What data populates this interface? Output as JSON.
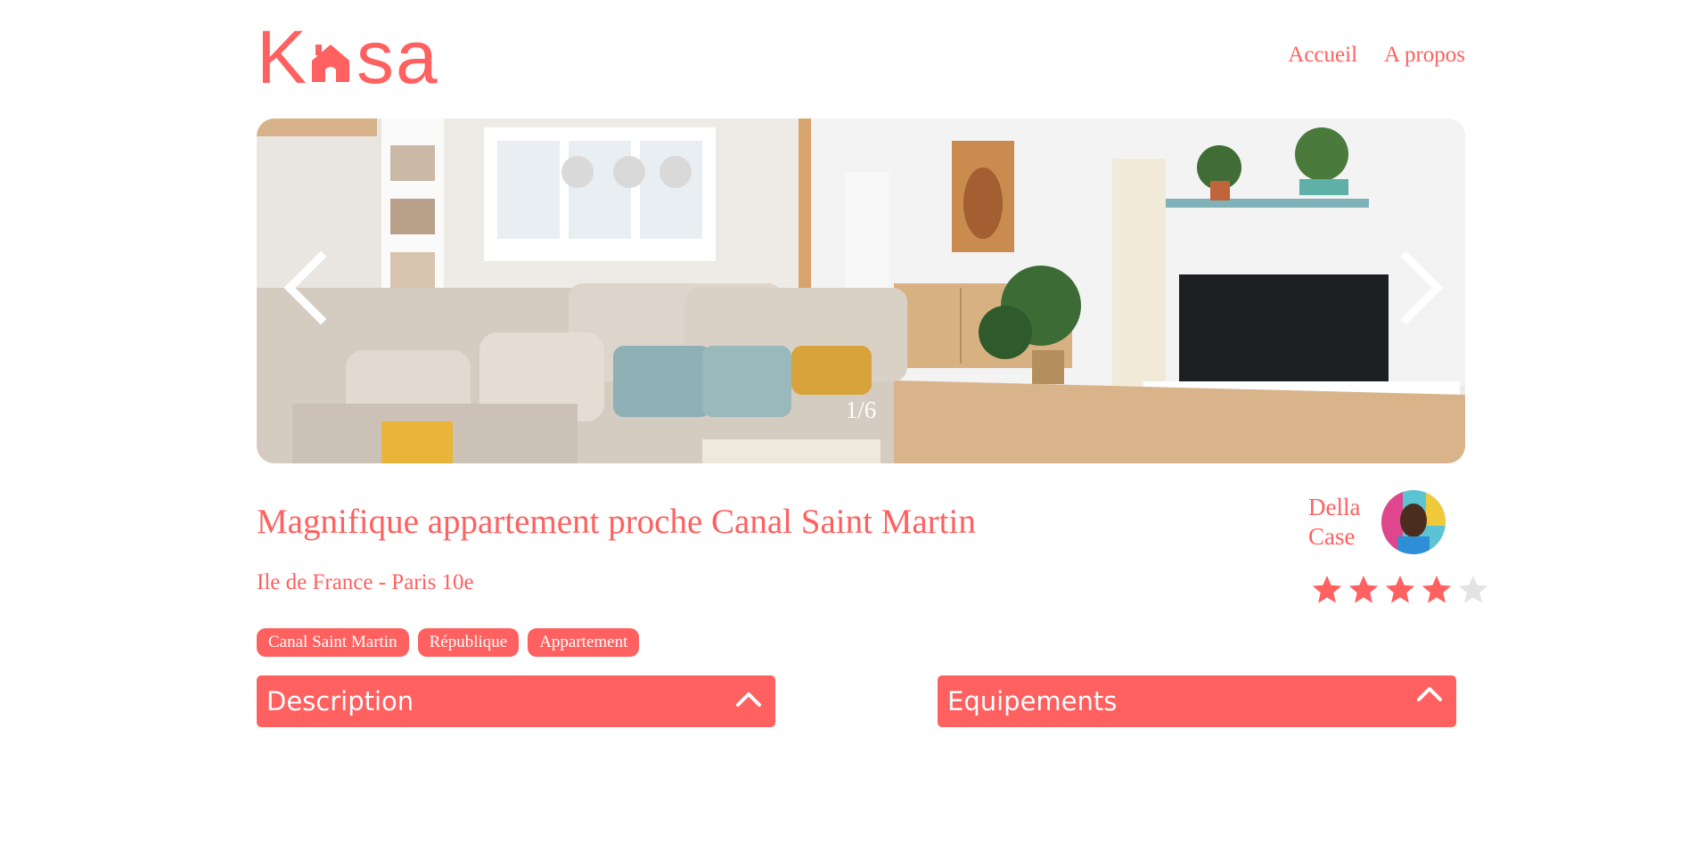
{
  "header": {
    "logo_text_start": "K",
    "logo_text_end": "sa",
    "logo_alt": "Kasa",
    "nav": [
      {
        "label": "Accueil"
      },
      {
        "label": "A propos"
      }
    ]
  },
  "gallery": {
    "counter": "1/6",
    "current_index": 1,
    "total": 6,
    "prev_icon": "chevron-left-icon",
    "next_icon": "chevron-right-icon"
  },
  "listing": {
    "title": "Magnifique appartement proche Canal Saint Martin",
    "location": "Ile de France - Paris 10e",
    "tags": [
      "Canal Saint Martin",
      "République",
      "Appartement"
    ]
  },
  "host": {
    "first_name": "Della",
    "last_name": "Case"
  },
  "rating": {
    "value": 4,
    "max": 5
  },
  "collapses": {
    "description": {
      "title": "Description",
      "icon": "chevron-up-icon"
    },
    "equipements": {
      "title": "Equipements",
      "icon": "chevron-up-icon"
    }
  },
  "colors": {
    "accent": "#FF6060",
    "star_empty": "#E3E3E3",
    "text_on_accent": "#FFFFFF"
  }
}
